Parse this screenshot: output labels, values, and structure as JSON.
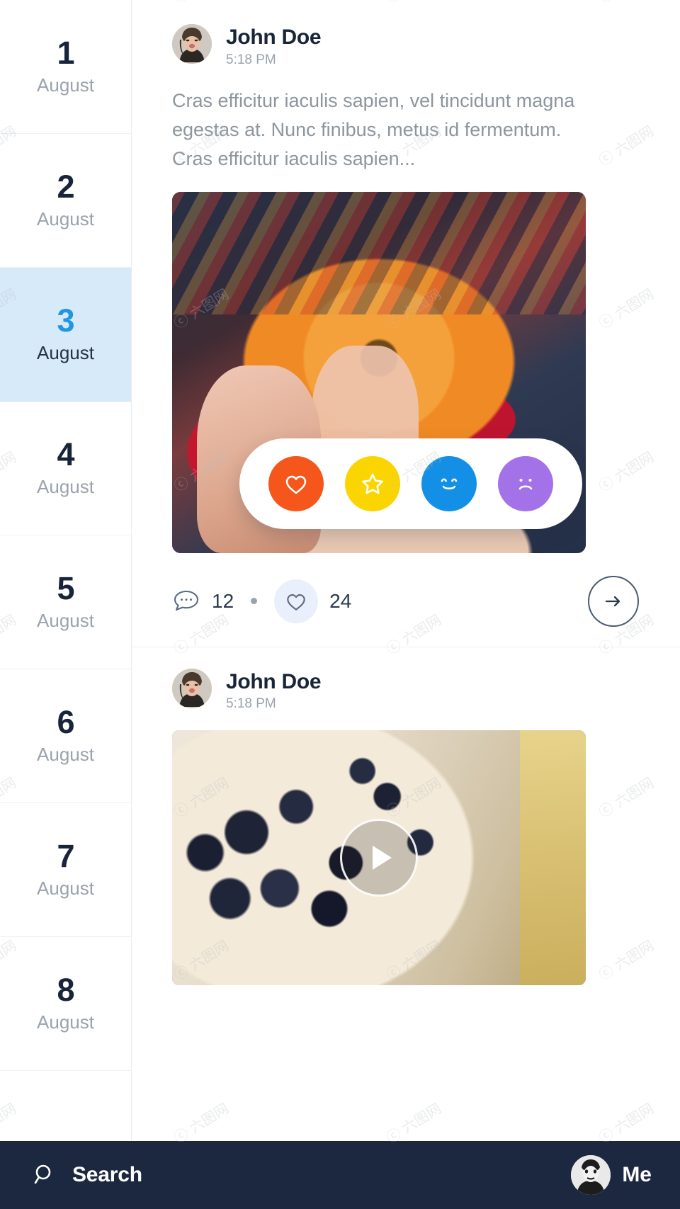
{
  "app": {
    "accent_blue": "#2196e3",
    "selected_bg": "#d6eaf9",
    "bottom_bar_bg": "#1c2840"
  },
  "sidebar": {
    "name": "date-list",
    "days": [
      {
        "num": "1",
        "month": "August",
        "selected": false
      },
      {
        "num": "2",
        "month": "August",
        "selected": false
      },
      {
        "num": "3",
        "month": "August",
        "selected": true
      },
      {
        "num": "4",
        "month": "August",
        "selected": false
      },
      {
        "num": "5",
        "month": "August",
        "selected": false
      },
      {
        "num": "6",
        "month": "August",
        "selected": false
      },
      {
        "num": "7",
        "month": "August",
        "selected": false
      },
      {
        "num": "8",
        "month": "August",
        "selected": false
      }
    ]
  },
  "feed": {
    "posts": [
      {
        "author": "John Doe",
        "time": "5:18 PM",
        "text": "Cras efficitur iaculis sapien, vel tincidunt magna egestas at. Nunc finibus, metus id fermentum. Cras efficitur iaculis sapien...",
        "media_type": "image",
        "media_alt": "donut-photo",
        "reactions": [
          {
            "name": "heart-reaction",
            "icon": "heart-icon",
            "color": "#f4561b"
          },
          {
            "name": "star-reaction",
            "icon": "star-icon",
            "color": "#fad502"
          },
          {
            "name": "smile-reaction",
            "icon": "smile-icon",
            "color": "#1390e5"
          },
          {
            "name": "sad-reaction",
            "icon": "sad-icon",
            "color": "#a372e8"
          }
        ],
        "comment_count": "12",
        "like_count": "24",
        "next_label": "→"
      },
      {
        "author": "John Doe",
        "time": "5:18 PM",
        "text": "",
        "media_type": "video",
        "media_alt": "berry-tart-video",
        "play_label": "play"
      }
    ]
  },
  "bottom_bar": {
    "search_label": "Search",
    "search_icon": "search-icon",
    "me_label": "Me",
    "me_avatar": "user-avatar"
  },
  "watermark": {
    "text": "六图网"
  }
}
